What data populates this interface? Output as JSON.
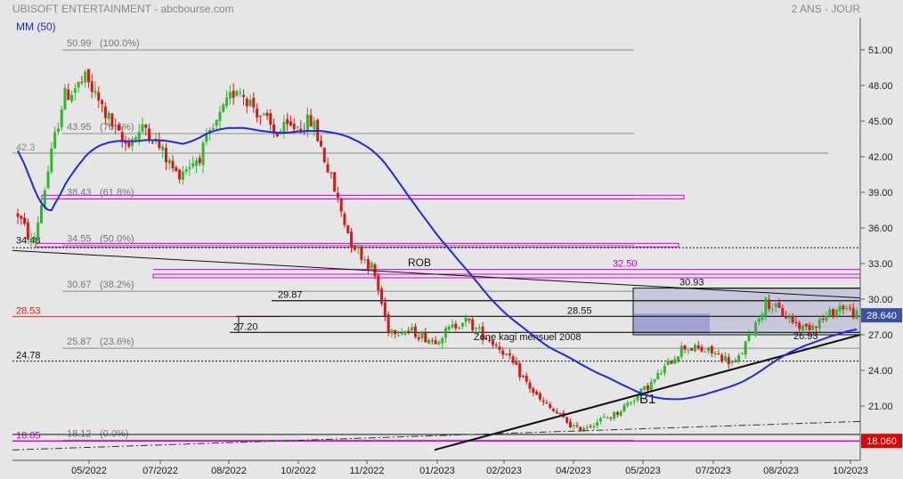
{
  "header": {
    "title": "UBISOFT ENTERTAINMENT - abcbourse.com",
    "period": "2 ANS - JOUR",
    "ma_label": "MM (50)"
  },
  "chart_data": {
    "type": "candlestick",
    "y_range": [
      17,
      52.5
    ],
    "y_ticks": [
      {
        "value": 51,
        "label": "51.00"
      },
      {
        "value": 48,
        "label": "48.00"
      },
      {
        "value": 45,
        "label": "45.00"
      },
      {
        "value": 42,
        "label": "42.00"
      },
      {
        "value": 39,
        "label": "39.00"
      },
      {
        "value": 36,
        "label": "36.00"
      },
      {
        "value": 33,
        "label": "33.00"
      },
      {
        "value": 30,
        "label": "30.00"
      },
      {
        "value": 27,
        "label": "27.00"
      },
      {
        "value": 24,
        "label": "24.00"
      },
      {
        "value": 21,
        "label": "21.00"
      }
    ],
    "x_labels": [
      "05/2022",
      "07/2022",
      "08/2022",
      "10/2022",
      "11/2022",
      "01/2023",
      "02/2023",
      "04/2023",
      "05/2023",
      "07/2023",
      "08/2023",
      "10/2023"
    ],
    "last_price": {
      "value": 28.64,
      "label": "28.640",
      "color": "#3c4fa0"
    },
    "low_marker": {
      "value": 18.06,
      "label": "18.060",
      "color": "#e00000"
    },
    "colors": {
      "up": "#2fb82f",
      "down": "#d81818",
      "ma": "#1f2bd8",
      "fib": "#808080",
      "magenta": "#d000d0",
      "red_line": "#ee2222"
    },
    "moving_average_label": "MM (50)",
    "fibonacci_levels": [
      {
        "value": 50.99,
        "label": "50.99",
        "pct": "(100.0%)"
      },
      {
        "value": 43.95,
        "label": "43.95",
        "pct": "(76.4%)"
      },
      {
        "value": 38.43,
        "label": "38.43",
        "pct": "(61.8%)"
      },
      {
        "value": 34.55,
        "label": "34.55",
        "pct": "(50.0%)"
      },
      {
        "value": 30.67,
        "label": "30.67",
        "pct": "(38.2%)"
      },
      {
        "value": 25.87,
        "label": "25.87",
        "pct": "(23.6%)"
      },
      {
        "value": 18.12,
        "label": "18.12",
        "pct": "(0.0%)"
      }
    ],
    "left_levels": [
      {
        "value": 42.3,
        "label": "42.3"
      },
      {
        "value": 34.48,
        "label": "34.48"
      },
      {
        "value": 28.53,
        "label": "28.53"
      },
      {
        "value": 24.78,
        "label": "24.78"
      },
      {
        "value": 18.05,
        "label": "18.05"
      }
    ],
    "horizontal_levels": [
      {
        "value": 32.5,
        "label": "32.50"
      },
      {
        "value": 30.93,
        "label": "30.93"
      },
      {
        "value": 29.87,
        "label": "29.87"
      },
      {
        "value": 28.55,
        "label": "28.55"
      },
      {
        "value": 27.2,
        "label": "27.20"
      },
      {
        "value": 26.93,
        "label": "26.93"
      }
    ],
    "annotations": {
      "rob": "ROB",
      "kagi_zone": "Zone kagi mensuel 2008",
      "b1": "B1"
    },
    "price_path_x": [
      0,
      0.3,
      0.7,
      1.0,
      1.5,
      1.8,
      2.2,
      2.5,
      3.0,
      3.5,
      4.0,
      4.5,
      4.8,
      5.0,
      5.3,
      5.6,
      6.0,
      6.5,
      7.0,
      7.5,
      8.0,
      8.5,
      8.9,
      9.3,
      9.6,
      10.0,
      10.5,
      10.8,
      11.0,
      11.2
    ],
    "price_path_y": [
      38.5,
      34.5,
      47,
      48.5,
      43,
      44.5,
      40.5,
      42,
      48,
      44,
      45,
      35,
      32.5,
      27.5,
      27.3,
      26.5,
      28.3,
      25.8,
      21.5,
      19.0,
      20.3,
      23.0,
      26.0,
      25.5,
      24.5,
      29.8,
      27.5,
      28.5,
      29.5,
      28.64
    ]
  }
}
